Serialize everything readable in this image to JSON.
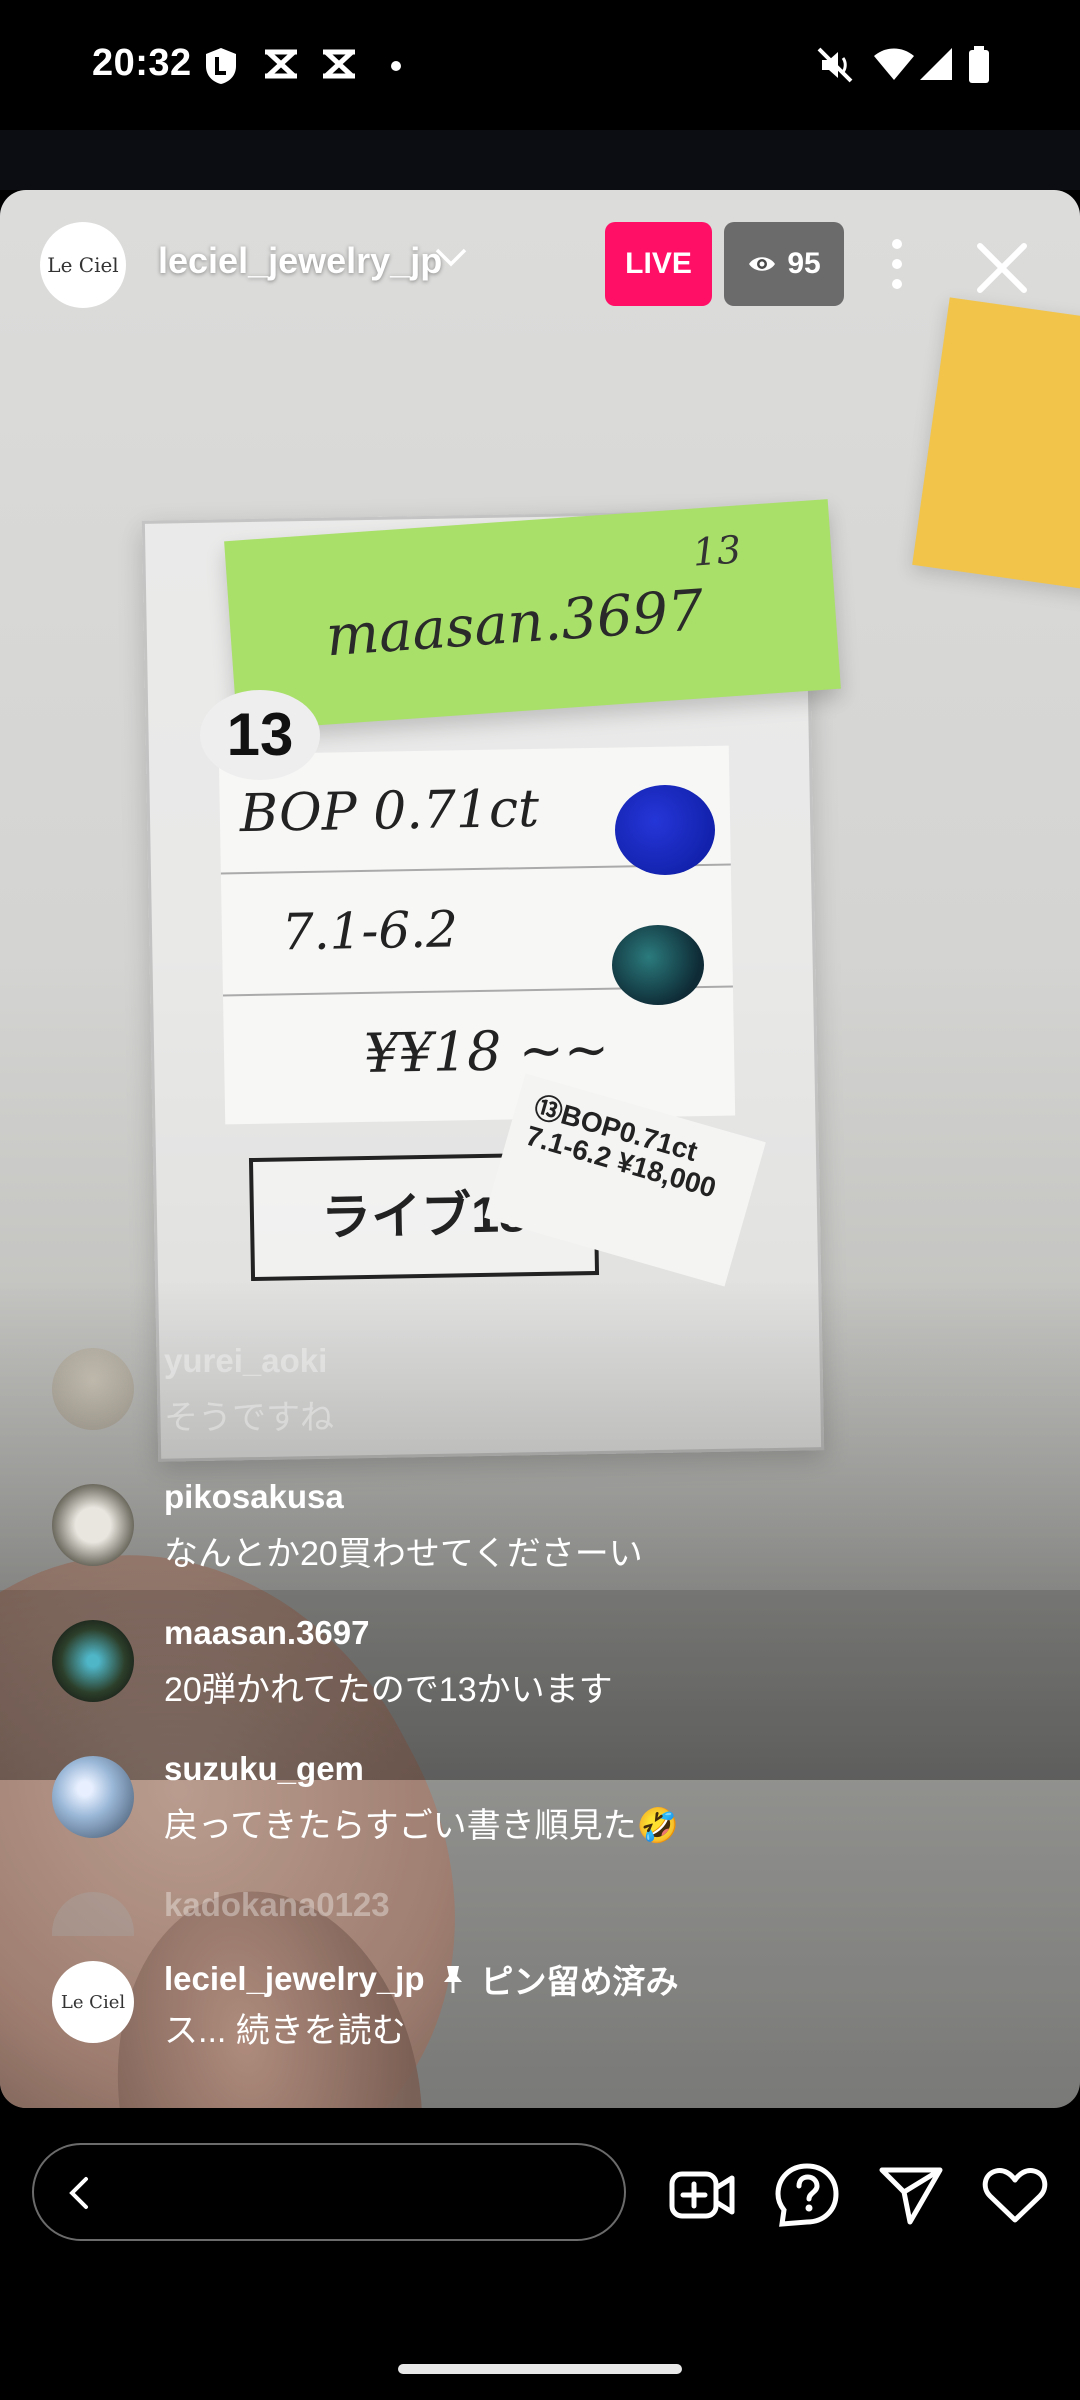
{
  "status_bar": {
    "time": "20:32",
    "left_icons": [
      "shield-l-icon",
      "capcut-icon",
      "capcut-icon",
      "dot-icon"
    ],
    "right_icons": [
      "mute-icon",
      "wifi-icon",
      "signal-icon",
      "battery-icon"
    ]
  },
  "live": {
    "host_avatar_text": "Le Ciel",
    "host_username": "leciel_jewelry_jp",
    "live_label": "LIVE",
    "viewer_count": "95"
  },
  "video_scene": {
    "green_note": "maasan.3697",
    "green_note_number": "13",
    "tag_number": "13",
    "label_line1": "BOP 0.71ct",
    "label_line2": "7.1-6.2",
    "label_line3": "¥¥18 ~~",
    "tag_text": "⑬BOP0.71ct 7.1-6.2 ¥18,000",
    "live_box": "ライブ18"
  },
  "comments": [
    {
      "user": "yurei_aoki",
      "text": "そうですね"
    },
    {
      "user": "pikosakusa",
      "text": "なんとか20買わせてくださーい"
    },
    {
      "user": "maasan.3697",
      "text": "20弾かれてたので13かいます"
    },
    {
      "user": "suzuku_gem",
      "text": "戻ってきたらすごい書き順見た🤣"
    },
    {
      "user": "kadokana0123",
      "text": ""
    }
  ],
  "pinned_comment": {
    "user": "leciel_jewelry_jp",
    "pin_label": "ピン留め済み",
    "text": "ス... 続きを読む",
    "avatar_text": "Le Ciel"
  },
  "bottom_bar": {
    "icons": [
      "add-video-icon",
      "question-icon",
      "send-icon",
      "heart-icon"
    ]
  }
}
